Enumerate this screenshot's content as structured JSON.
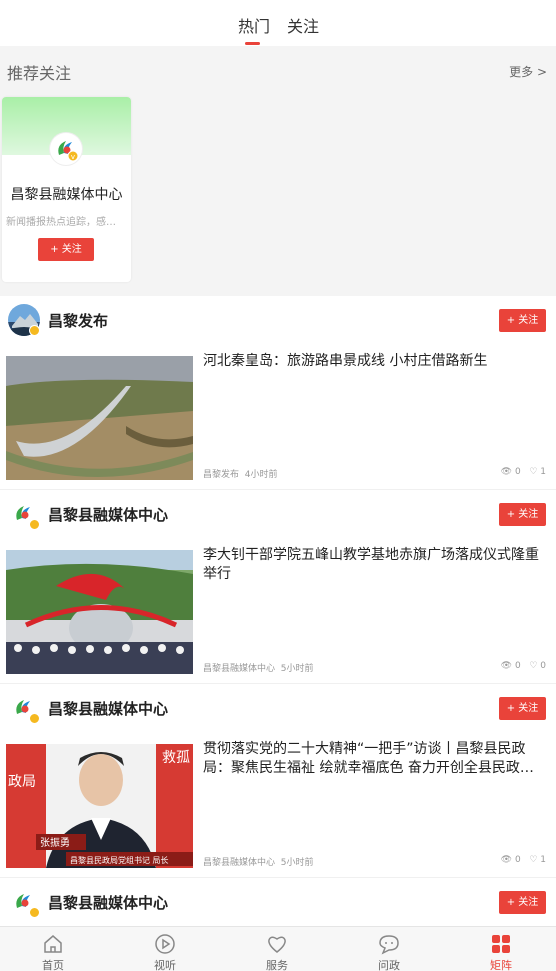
{
  "tabs": [
    {
      "label": "热门",
      "active": true
    },
    {
      "label": "关注",
      "active": false
    }
  ],
  "recommend": {
    "title": "推荐关注",
    "more": "更多 >",
    "cards": [
      {
        "name": "昌黎县融媒体中心",
        "desc": "新闻播报热点追踪，感…",
        "follow_label": "+ 关注"
      }
    ]
  },
  "posts": [
    {
      "author": "昌黎发布",
      "follow_label": "+ 关注",
      "headline": "河北秦皇岛：旅游路串景成线 小村庄借路新生",
      "source": "昌黎发布",
      "time": "4小时前",
      "views": "0",
      "likes": "1"
    },
    {
      "author": "昌黎县融媒体中心",
      "follow_label": "+ 关注",
      "headline": "李大钊干部学院五峰山教学基地赤旗广场落成仪式隆重举行",
      "source": "昌黎县融媒体中心",
      "time": "5小时前",
      "views": "0",
      "likes": "0"
    },
    {
      "author": "昌黎县融媒体中心",
      "follow_label": "+ 关注",
      "headline": "贯彻落实党的二十大精神“一把手”访谈丨昌黎县民政局：聚焦民生福祉 绘就幸福底色 奋力开创全县民政…",
      "source": "昌黎县融媒体中心",
      "time": "5小时前",
      "views": "0",
      "likes": "1",
      "image_captions": {
        "name": "张振勇",
        "title": "昌黎县民政局党组书记  局长",
        "sign_left": "政局",
        "sign_right": "救孤"
      }
    },
    {
      "author": "昌黎县融媒体中心",
      "follow_label": "+ 关注"
    }
  ],
  "bottom_nav": [
    {
      "label": "首页",
      "icon": "home-icon",
      "active": false
    },
    {
      "label": "视听",
      "icon": "play-icon",
      "active": false
    },
    {
      "label": "服务",
      "icon": "heart-icon",
      "active": false
    },
    {
      "label": "问政",
      "icon": "chat-icon",
      "active": false
    },
    {
      "label": "矩阵",
      "icon": "grid-icon",
      "active": true
    }
  ],
  "colors": {
    "accent": "#e9433a",
    "badge": "#f5b920"
  }
}
